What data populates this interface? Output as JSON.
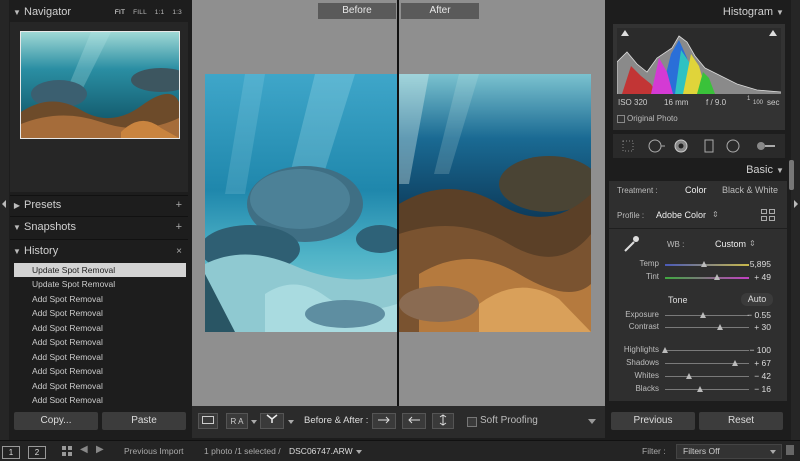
{
  "navigator": {
    "title": "Navigator",
    "zoom_options": [
      "FIT",
      "FILL",
      "1:1",
      "1:3"
    ],
    "selected_zoom": "FIT"
  },
  "panels": {
    "presets": "Presets",
    "snapshots": "Snapshots",
    "history": "History"
  },
  "history_items": [
    "Update Spot Removal",
    "Update Spot Removal",
    "Add Spot Removal",
    "Add Spot Removal",
    "Add Spot Removal",
    "Add Spot Removal",
    "Add Spot Removal",
    "Add Spot Removal",
    "Add Spot Removal",
    "Add Spot Removal"
  ],
  "left_buttons": {
    "copy": "Copy...",
    "paste": "Paste"
  },
  "view": {
    "before_label": "Before",
    "after_label": "After"
  },
  "toolbar": {
    "before_after_label": "Before & After :",
    "soft_proofing": "Soft Proofing",
    "ra_label": "R A"
  },
  "histogram": {
    "title": "Histogram",
    "iso": "ISO 320",
    "focal": "16 mm",
    "aperture": "f / 9.0",
    "shutter_num": "1",
    "shutter_den": "100",
    "shutter_unit": "sec",
    "original_photo": "Original Photo"
  },
  "basic": {
    "title": "Basic",
    "treatment_label": "Treatment :",
    "treatment_color": "Color",
    "treatment_bw": "Black & White",
    "profile_label": "Profile :",
    "profile_value": "Adobe Color",
    "wb_label": "WB :",
    "wb_value": "Custom",
    "tone_label": "Tone",
    "auto_label": "Auto"
  },
  "sliders": [
    {
      "label": "Temp",
      "value": "5,895",
      "level": 0.46
    },
    {
      "label": "Tint",
      "value": "+ 49",
      "level": 0.62
    },
    {
      "label": "Exposure",
      "value": "− 0.55",
      "level": 0.45
    },
    {
      "label": "Contrast",
      "value": "+ 30",
      "level": 0.65
    },
    {
      "label": "Highlights",
      "value": "− 100",
      "level": 0.0
    },
    {
      "label": "Shadows",
      "value": "+ 67",
      "level": 0.83
    },
    {
      "label": "Whites",
      "value": "− 42",
      "level": 0.29
    },
    {
      "label": "Blacks",
      "value": "− 16",
      "level": 0.42
    }
  ],
  "right_buttons": {
    "previous": "Previous",
    "reset": "Reset"
  },
  "filmstrip": {
    "view1": "1",
    "view2": "2",
    "source": "Previous Import",
    "count": "1 photo /1 selected /",
    "filename": "DSC06747.ARW",
    "filter_label": "Filter :",
    "filter_value": "Filters Off"
  },
  "colors": {
    "accent": "#d3d3d3",
    "panel": "#2b2b2b",
    "background": "#8f8f8f"
  }
}
